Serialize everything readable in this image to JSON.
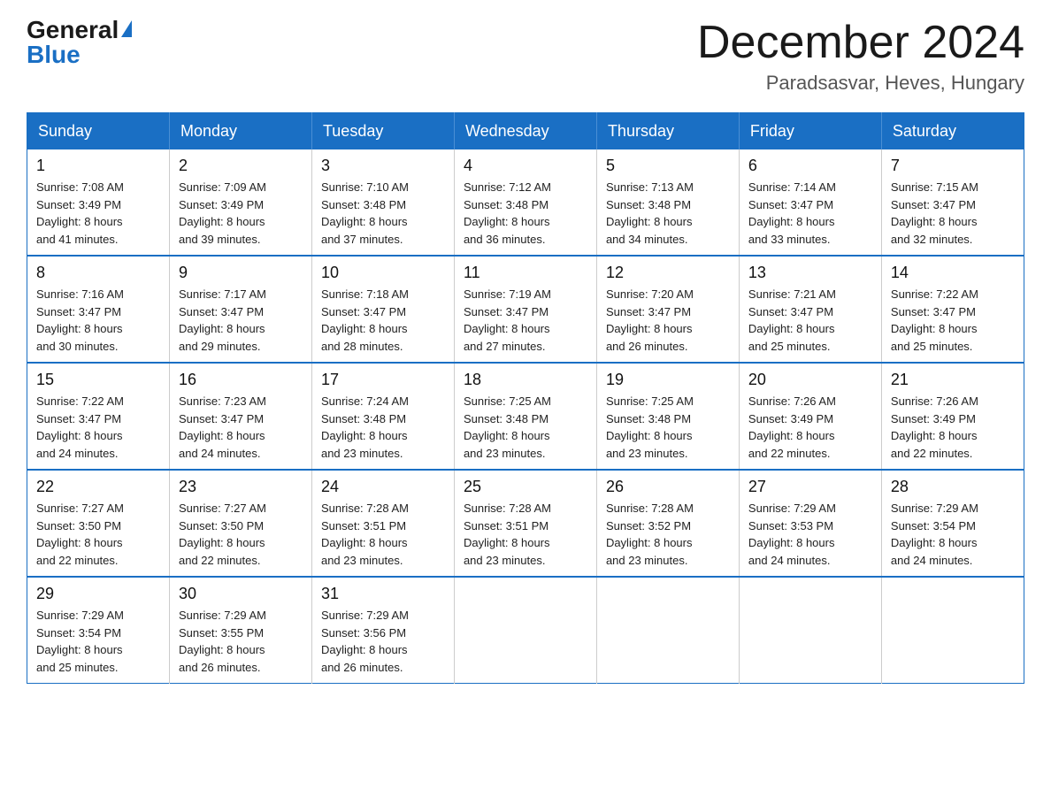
{
  "logo": {
    "general": "General",
    "blue": "Blue",
    "triangle": "▶"
  },
  "title": {
    "month": "December 2024",
    "location": "Paradsasvar, Heves, Hungary"
  },
  "weekdays": [
    "Sunday",
    "Monday",
    "Tuesday",
    "Wednesday",
    "Thursday",
    "Friday",
    "Saturday"
  ],
  "weeks": [
    [
      {
        "day": "1",
        "sunrise": "7:08 AM",
        "sunset": "3:49 PM",
        "daylight": "8 hours and 41 minutes."
      },
      {
        "day": "2",
        "sunrise": "7:09 AM",
        "sunset": "3:49 PM",
        "daylight": "8 hours and 39 minutes."
      },
      {
        "day": "3",
        "sunrise": "7:10 AM",
        "sunset": "3:48 PM",
        "daylight": "8 hours and 37 minutes."
      },
      {
        "day": "4",
        "sunrise": "7:12 AM",
        "sunset": "3:48 PM",
        "daylight": "8 hours and 36 minutes."
      },
      {
        "day": "5",
        "sunrise": "7:13 AM",
        "sunset": "3:48 PM",
        "daylight": "8 hours and 34 minutes."
      },
      {
        "day": "6",
        "sunrise": "7:14 AM",
        "sunset": "3:47 PM",
        "daylight": "8 hours and 33 minutes."
      },
      {
        "day": "7",
        "sunrise": "7:15 AM",
        "sunset": "3:47 PM",
        "daylight": "8 hours and 32 minutes."
      }
    ],
    [
      {
        "day": "8",
        "sunrise": "7:16 AM",
        "sunset": "3:47 PM",
        "daylight": "8 hours and 30 minutes."
      },
      {
        "day": "9",
        "sunrise": "7:17 AM",
        "sunset": "3:47 PM",
        "daylight": "8 hours and 29 minutes."
      },
      {
        "day": "10",
        "sunrise": "7:18 AM",
        "sunset": "3:47 PM",
        "daylight": "8 hours and 28 minutes."
      },
      {
        "day": "11",
        "sunrise": "7:19 AM",
        "sunset": "3:47 PM",
        "daylight": "8 hours and 27 minutes."
      },
      {
        "day": "12",
        "sunrise": "7:20 AM",
        "sunset": "3:47 PM",
        "daylight": "8 hours and 26 minutes."
      },
      {
        "day": "13",
        "sunrise": "7:21 AM",
        "sunset": "3:47 PM",
        "daylight": "8 hours and 25 minutes."
      },
      {
        "day": "14",
        "sunrise": "7:22 AM",
        "sunset": "3:47 PM",
        "daylight": "8 hours and 25 minutes."
      }
    ],
    [
      {
        "day": "15",
        "sunrise": "7:22 AM",
        "sunset": "3:47 PM",
        "daylight": "8 hours and 24 minutes."
      },
      {
        "day": "16",
        "sunrise": "7:23 AM",
        "sunset": "3:47 PM",
        "daylight": "8 hours and 24 minutes."
      },
      {
        "day": "17",
        "sunrise": "7:24 AM",
        "sunset": "3:48 PM",
        "daylight": "8 hours and 23 minutes."
      },
      {
        "day": "18",
        "sunrise": "7:25 AM",
        "sunset": "3:48 PM",
        "daylight": "8 hours and 23 minutes."
      },
      {
        "day": "19",
        "sunrise": "7:25 AM",
        "sunset": "3:48 PM",
        "daylight": "8 hours and 23 minutes."
      },
      {
        "day": "20",
        "sunrise": "7:26 AM",
        "sunset": "3:49 PM",
        "daylight": "8 hours and 22 minutes."
      },
      {
        "day": "21",
        "sunrise": "7:26 AM",
        "sunset": "3:49 PM",
        "daylight": "8 hours and 22 minutes."
      }
    ],
    [
      {
        "day": "22",
        "sunrise": "7:27 AM",
        "sunset": "3:50 PM",
        "daylight": "8 hours and 22 minutes."
      },
      {
        "day": "23",
        "sunrise": "7:27 AM",
        "sunset": "3:50 PM",
        "daylight": "8 hours and 22 minutes."
      },
      {
        "day": "24",
        "sunrise": "7:28 AM",
        "sunset": "3:51 PM",
        "daylight": "8 hours and 23 minutes."
      },
      {
        "day": "25",
        "sunrise": "7:28 AM",
        "sunset": "3:51 PM",
        "daylight": "8 hours and 23 minutes."
      },
      {
        "day": "26",
        "sunrise": "7:28 AM",
        "sunset": "3:52 PM",
        "daylight": "8 hours and 23 minutes."
      },
      {
        "day": "27",
        "sunrise": "7:29 AM",
        "sunset": "3:53 PM",
        "daylight": "8 hours and 24 minutes."
      },
      {
        "day": "28",
        "sunrise": "7:29 AM",
        "sunset": "3:54 PM",
        "daylight": "8 hours and 24 minutes."
      }
    ],
    [
      {
        "day": "29",
        "sunrise": "7:29 AM",
        "sunset": "3:54 PM",
        "daylight": "8 hours and 25 minutes."
      },
      {
        "day": "30",
        "sunrise": "7:29 AM",
        "sunset": "3:55 PM",
        "daylight": "8 hours and 26 minutes."
      },
      {
        "day": "31",
        "sunrise": "7:29 AM",
        "sunset": "3:56 PM",
        "daylight": "8 hours and 26 minutes."
      },
      null,
      null,
      null,
      null
    ]
  ],
  "labels": {
    "sunrise": "Sunrise:",
    "sunset": "Sunset:",
    "daylight": "Daylight:"
  }
}
